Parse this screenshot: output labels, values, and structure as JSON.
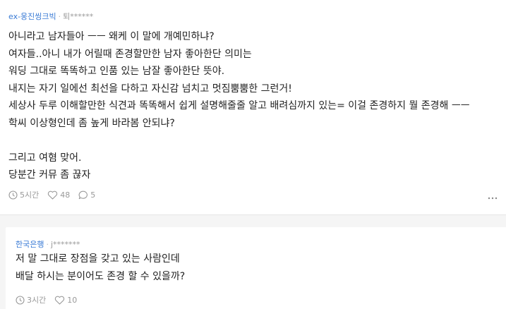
{
  "post": {
    "company": "ex-웅진씽크빅",
    "user": "퇴******",
    "lines": [
      "아니라고 남자들아 ㅡㅡ 왜케 이 말에 개예민하냐?",
      "여자들..아니 내가 어릴때 존경할만한 남자 좋아한단 의미는",
      "워딩 그대로 똑똑하고 인품 있는 남잘 좋아한단 뜻야.",
      "내지는 자기 일에선 최선을 다하고 자신감 넘치고 멋짐뿜뿜한 그런거!",
      "세상사 두루 이해할만한 식견과 똑똑해서 쉽게 설명해줄줄 알고 배려심까지 있는= 이걸 존경하지 뭘 존경해 ㅡㅡ",
      "학씨 이상형인데 좀 높게 바라봄 안되냐?",
      "",
      "그리고 여혐 맞어.",
      "당분간 커뮤 좀 끊자"
    ],
    "time": "5시간",
    "likes": "48",
    "comments": "5"
  },
  "reply": {
    "company": "한국은행",
    "user": "j*******",
    "lines": [
      "저 말 그대로 장점을 갖고 있는 사람인데",
      "배달 하시는 분이어도 존경 할 수 있을까?"
    ],
    "time": "3시간",
    "likes": "10"
  },
  "colors": {
    "company": "#3a7bd5",
    "muted": "#999999",
    "text": "#222222",
    "reply_bg": "#f5f5f5"
  },
  "icons": {
    "time": "clock-icon",
    "like": "heart-icon",
    "comment": "speech-bubble-icon",
    "more": "more-dots-icon"
  }
}
